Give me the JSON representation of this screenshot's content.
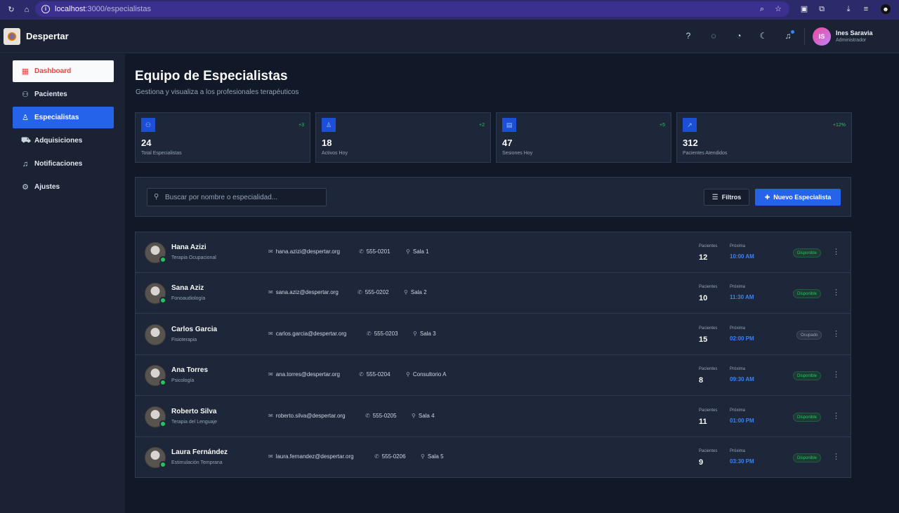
{
  "browser": {
    "url_host": "localhost",
    "url_path": ":3000/especialistas"
  },
  "header": {
    "app_name": "Despertar",
    "user": {
      "initials": "IS",
      "name": "Ines Saravia",
      "role": "Administrador"
    },
    "icons": [
      "help-icon",
      "chat-icon",
      "palette-icon",
      "moon-icon",
      "bell-icon"
    ]
  },
  "sidebar": {
    "items": [
      {
        "label": "Dashboard",
        "icon": "grid-icon"
      },
      {
        "label": "Pacientes",
        "icon": "users-icon"
      },
      {
        "label": "Especialistas",
        "icon": "user-cog-icon"
      },
      {
        "label": "Adquisiciones",
        "icon": "cart-icon"
      },
      {
        "label": "Notificaciones",
        "icon": "bell-icon"
      },
      {
        "label": "Ajustes",
        "icon": "gear-icon"
      }
    ]
  },
  "page": {
    "title": "Equipo de Especialistas",
    "subtitle": "Gestiona y visualiza a los profesionales terapéuticos"
  },
  "stats": [
    {
      "value": "24",
      "label": "Total Especialistas",
      "trend": "+3"
    },
    {
      "value": "18",
      "label": "Activos Hoy",
      "trend": "+2"
    },
    {
      "value": "47",
      "label": "Sesiones Hoy",
      "trend": "+5"
    },
    {
      "value": "312",
      "label": "Pacientes Atendidos",
      "trend": "+12%"
    }
  ],
  "toolbar": {
    "search_placeholder": "Buscar por nombre o especialidad...",
    "filters_label": "Filtros",
    "new_label": "Nuevo Especialista"
  },
  "list_labels": {
    "patients": "Pacientes",
    "next": "Próxima"
  },
  "specialists": [
    {
      "name": "Hana Azizi",
      "specialty": "Terapia Ocupacional",
      "email": "hana.azizi@despertar.org",
      "phone": "555-0201",
      "room": "Sala 1",
      "patients": "12",
      "next": "10:00 AM",
      "status": "Disponible"
    },
    {
      "name": "Sana Aziz",
      "specialty": "Fonoaudiología",
      "email": "sana.aziz@despertar.org",
      "phone": "555-0202",
      "room": "Sala 2",
      "patients": "10",
      "next": "11:30 AM",
      "status": "Disponible"
    },
    {
      "name": "Carlos Garcia",
      "specialty": "Fisioterapia",
      "email": "carlos.garcia@despertar.org",
      "phone": "555-0203",
      "room": "Sala 3",
      "patients": "15",
      "next": "02:00 PM",
      "status": "Ocupado"
    },
    {
      "name": "Ana Torres",
      "specialty": "Psicología",
      "email": "ana.torres@despertar.org",
      "phone": "555-0204",
      "room": "Consultorio A",
      "patients": "8",
      "next": "09:30 AM",
      "status": "Disponible"
    },
    {
      "name": "Roberto Silva",
      "specialty": "Terapia del Lenguaje",
      "email": "roberto.silva@despertar.org",
      "phone": "555-0205",
      "room": "Sala 4",
      "patients": "11",
      "next": "01:00 PM",
      "status": "Disponible"
    },
    {
      "name": "Laura Fernández",
      "specialty": "Estimulación Temprana",
      "email": "laura.fernandez@despertar.org",
      "phone": "555-0206",
      "room": "Sala 5",
      "patients": "9",
      "next": "03:30 PM",
      "status": "Disponible"
    }
  ]
}
